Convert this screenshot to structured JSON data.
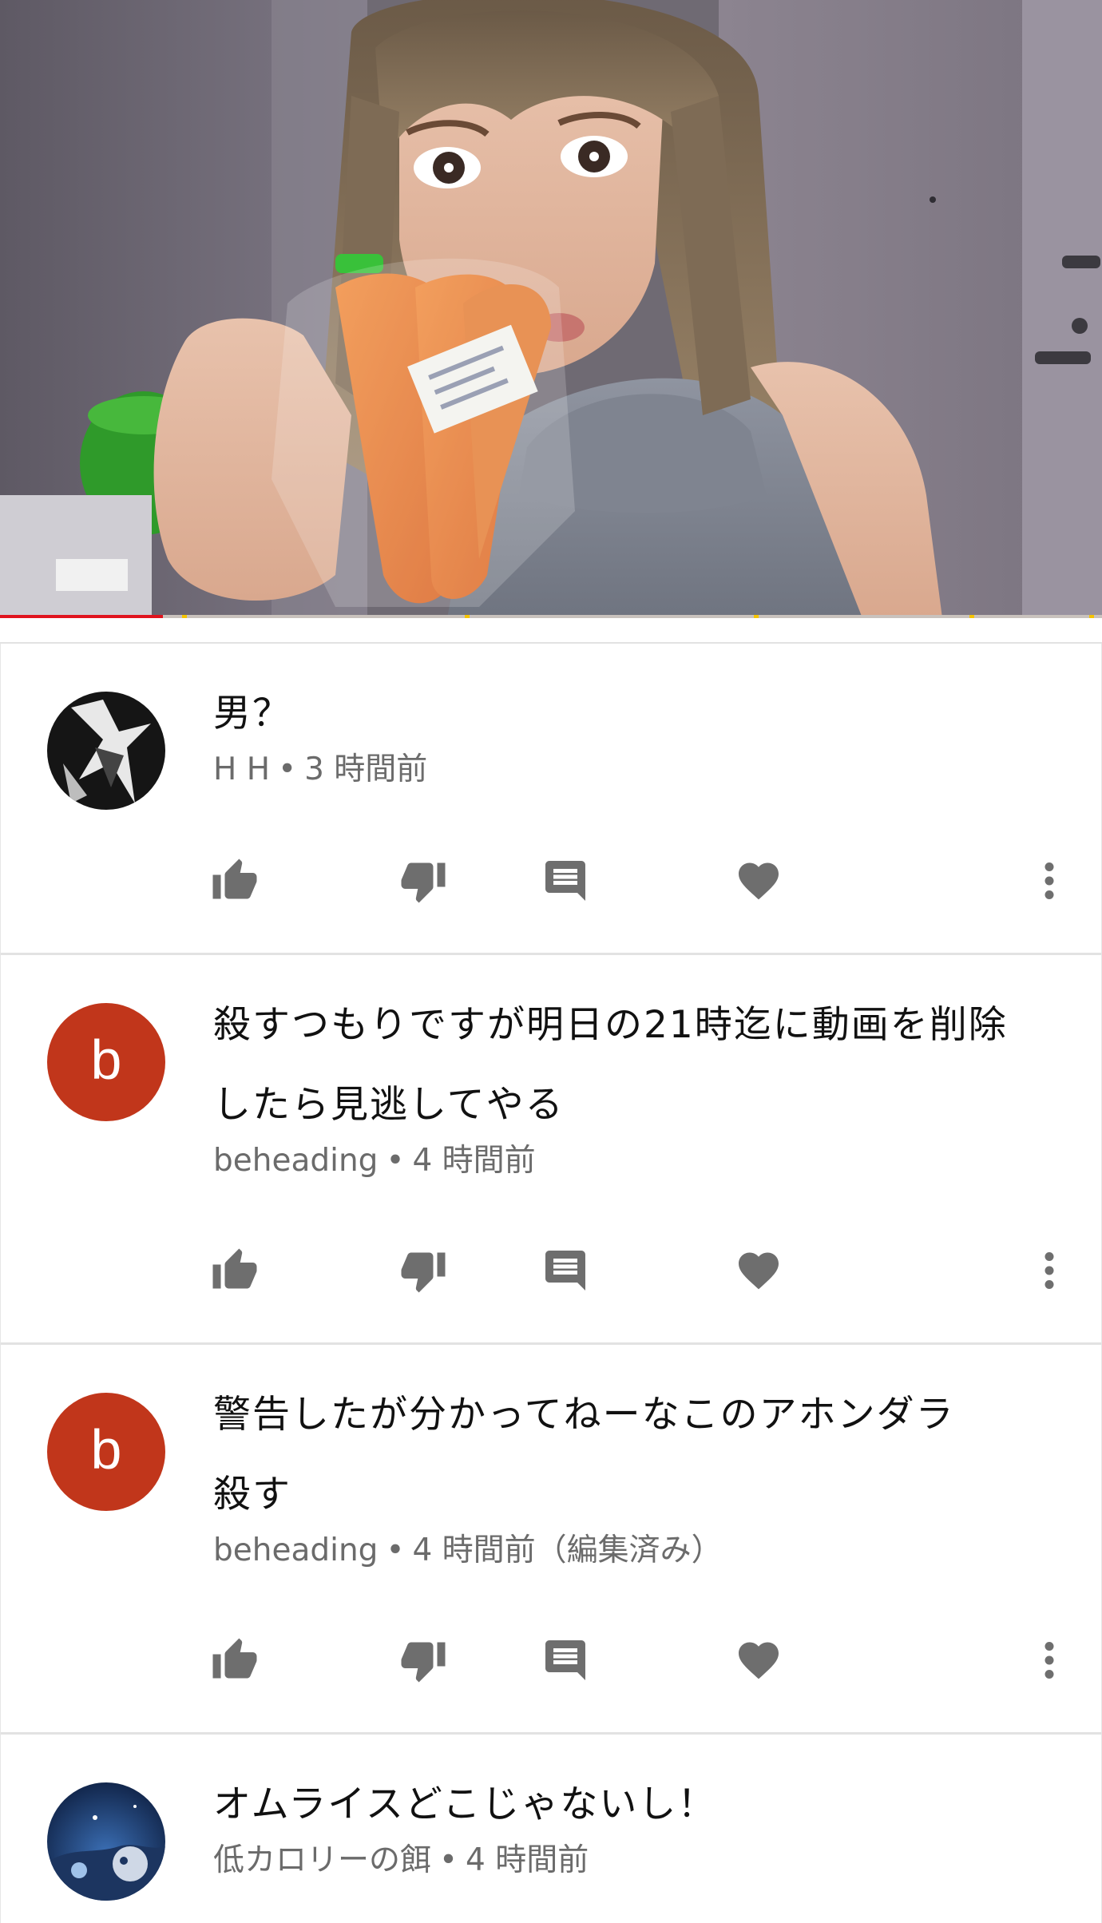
{
  "video": {
    "progress_percent": 14.8
  },
  "comments": [
    {
      "text_lines": [
        "男？"
      ],
      "author": "H H",
      "time": "3 時間前",
      "avatar": {
        "kind": "image",
        "icon": "dark-figure-avatar"
      }
    },
    {
      "text_lines": [
        "殺すつもりですが明日の21時迄に動画を削除",
        "したら見逃してやる"
      ],
      "author": "beheading",
      "time": "4 時間前",
      "avatar": {
        "kind": "letter",
        "letter": "b",
        "color": "#c1361b"
      }
    },
    {
      "text_lines": [
        "警告したが分かってねーなこのアホンダラ",
        "殺す"
      ],
      "author": "beheading",
      "time": "4 時間前（編集済み）",
      "avatar": {
        "kind": "letter",
        "letter": "b",
        "color": "#c1361b"
      }
    },
    {
      "text_lines": [
        "オムライスどこじゃないし！"
      ],
      "author": "低カロリーの餌",
      "time": "4 時間前",
      "avatar": {
        "kind": "image",
        "icon": "night-scene-avatar"
      }
    }
  ],
  "action_icons": [
    "thumb-up-icon",
    "thumb-down-icon",
    "reply-icon",
    "heart-icon",
    "more-vert-icon"
  ],
  "separator": "•"
}
